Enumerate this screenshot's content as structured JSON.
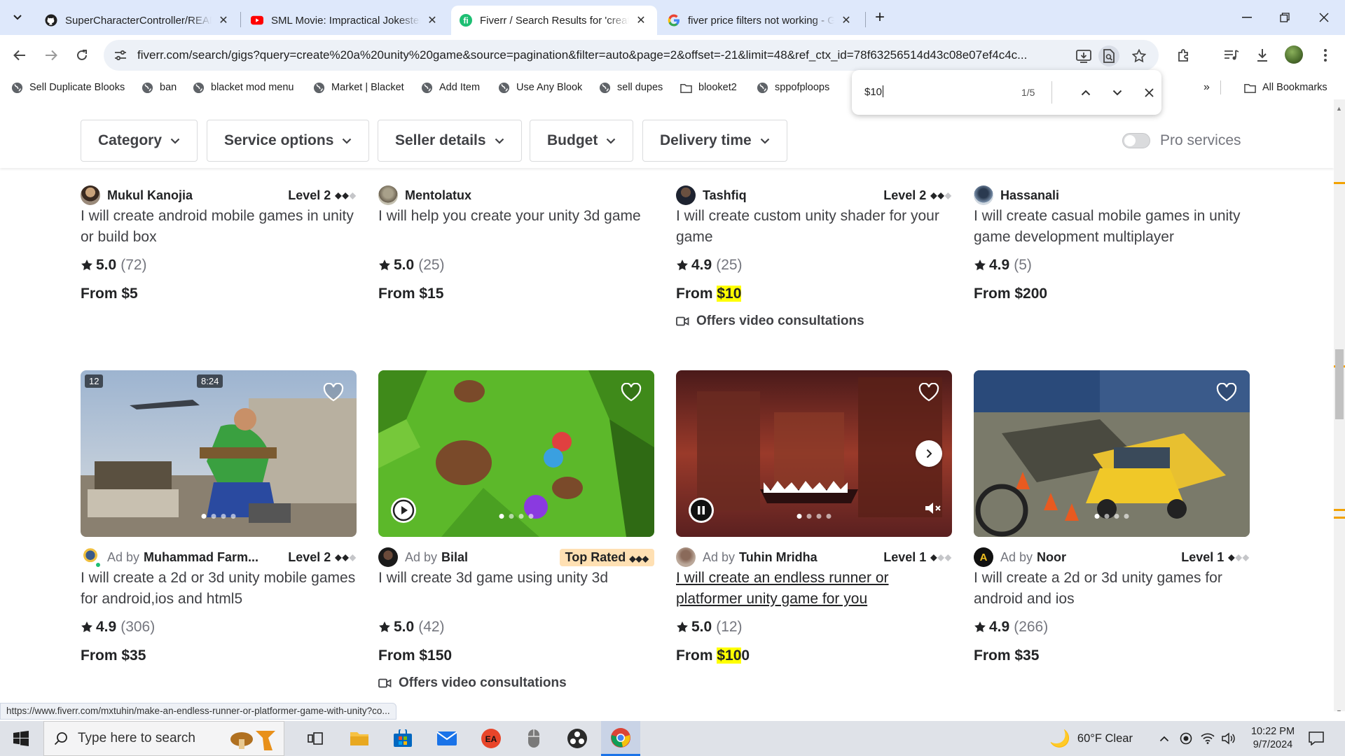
{
  "tabs": [
    {
      "title": "SuperCharacterController/README",
      "icon": "github-icon"
    },
    {
      "title": "SML Movie: Impractical Jokester",
      "icon": "youtube-icon"
    },
    {
      "title": "Fiverr / Search Results for 'create",
      "icon": "fiverr-icon",
      "active": true
    },
    {
      "title": "fiver price filters not working - Google",
      "icon": "google-icon"
    }
  ],
  "url": "fiverr.com/search/gigs?query=create%20a%20unity%20game&source=pagination&filter=auto&page=2&offset=-21&limit=48&ref_ctx_id=78f63256514d43c08e07ef4c4c...",
  "bookmarks": [
    {
      "label": "Sell Duplicate Blooks",
      "icon": "globe-icon"
    },
    {
      "label": "ban",
      "icon": "globe-icon"
    },
    {
      "label": "blacket mod menu",
      "icon": "globe-icon"
    },
    {
      "label": "Market | Blacket",
      "icon": "globe-icon"
    },
    {
      "label": "Add Item",
      "icon": "globe-icon"
    },
    {
      "label": "Use Any Blook",
      "icon": "globe-icon"
    },
    {
      "label": "sell dupes",
      "icon": "globe-icon"
    },
    {
      "label": "blooket2",
      "icon": "folder-icon"
    },
    {
      "label": "sppofploops",
      "icon": "globe-icon"
    }
  ],
  "all_bookmarks": "All Bookmarks",
  "find": {
    "query": "$10",
    "count": "1/5"
  },
  "filters": {
    "category": "Category",
    "service_options": "Service options",
    "seller_details": "Seller details",
    "budget": "Budget",
    "delivery_time": "Delivery time",
    "pro_services": "Pro services"
  },
  "row1": [
    {
      "seller": "Mukul Kanojia",
      "level": "Level 2",
      "level_n": 2,
      "title": "I will create android mobile games in unity or build box",
      "score": "5.0",
      "count": "(72)",
      "price_prefix": "From ",
      "price_hl": "",
      "price_rest": "$5",
      "video": ""
    },
    {
      "seller": "Mentolatux",
      "level": "",
      "level_n": 0,
      "title": "I will help you create your unity 3d game",
      "score": "5.0",
      "count": "(25)",
      "price_prefix": "From ",
      "price_hl": "",
      "price_rest": "$15",
      "video": ""
    },
    {
      "seller": "Tashfiq",
      "level": "Level 2",
      "level_n": 2,
      "title": "I will create custom unity shader for your game",
      "score": "4.9",
      "count": "(25)",
      "price_prefix": "From ",
      "price_hl": "$10",
      "price_rest": "",
      "video": "Offers video consultations"
    },
    {
      "seller": "Hassanali",
      "level": "",
      "level_n": 0,
      "title": "I will create casual mobile games in unity game development multiplayer",
      "score": "4.9",
      "count": "(5)",
      "price_prefix": "From ",
      "price_hl": "",
      "price_rest": "$200",
      "video": ""
    }
  ],
  "row2": [
    {
      "ad": "Ad by",
      "seller": "Muhammad Farm...",
      "level": "Level 2",
      "level_n": 2,
      "title": "I will create a 2d or 3d unity mobile games for android,ios and html5",
      "score": "4.9",
      "count": "(306)",
      "price_prefix": "From ",
      "price_hl": "",
      "price_rest": "$35",
      "video": "",
      "overlay_badge": "12",
      "overlay_time": "8:24"
    },
    {
      "ad": "Ad by",
      "seller": "Bilal",
      "level": "Top Rated",
      "level_n": 3,
      "title": "I will create 3d game using unity 3d",
      "score": "5.0",
      "count": "(42)",
      "price_prefix": "From ",
      "price_hl": "",
      "price_rest": "$150",
      "video": "Offers video consultations"
    },
    {
      "ad": "Ad by",
      "seller": "Tuhin Mridha",
      "level": "Level 1",
      "level_n": 1,
      "title": "I will create an endless runner or platformer unity game for you",
      "score": "5.0",
      "count": "(12)",
      "price_prefix": "From ",
      "price_hl": "$10",
      "price_rest": "0",
      "video": ""
    },
    {
      "ad": "Ad by",
      "seller": "Noor",
      "level": "Level 1",
      "level_n": 1,
      "title": "I will create a 2d or 3d unity games for android and ios",
      "score": "4.9",
      "count": "(266)",
      "price_prefix": "From ",
      "price_hl": "",
      "price_rest": "$35",
      "video": ""
    }
  ],
  "status_url": "https://www.fiverr.com/mxtuhin/make-an-endless-runner-or-platformer-game-with-unity?co...",
  "taskbar": {
    "search_placeholder": "Type here to search",
    "weather": "60°F  Clear",
    "time": "10:22 PM",
    "date": "9/7/2024"
  },
  "colors": {
    "highlight": "#ffff00",
    "top_rated_bg": "#ffe0b3",
    "tab_strip": "#dee8fb",
    "fiverr_green": "#1dbf73"
  }
}
